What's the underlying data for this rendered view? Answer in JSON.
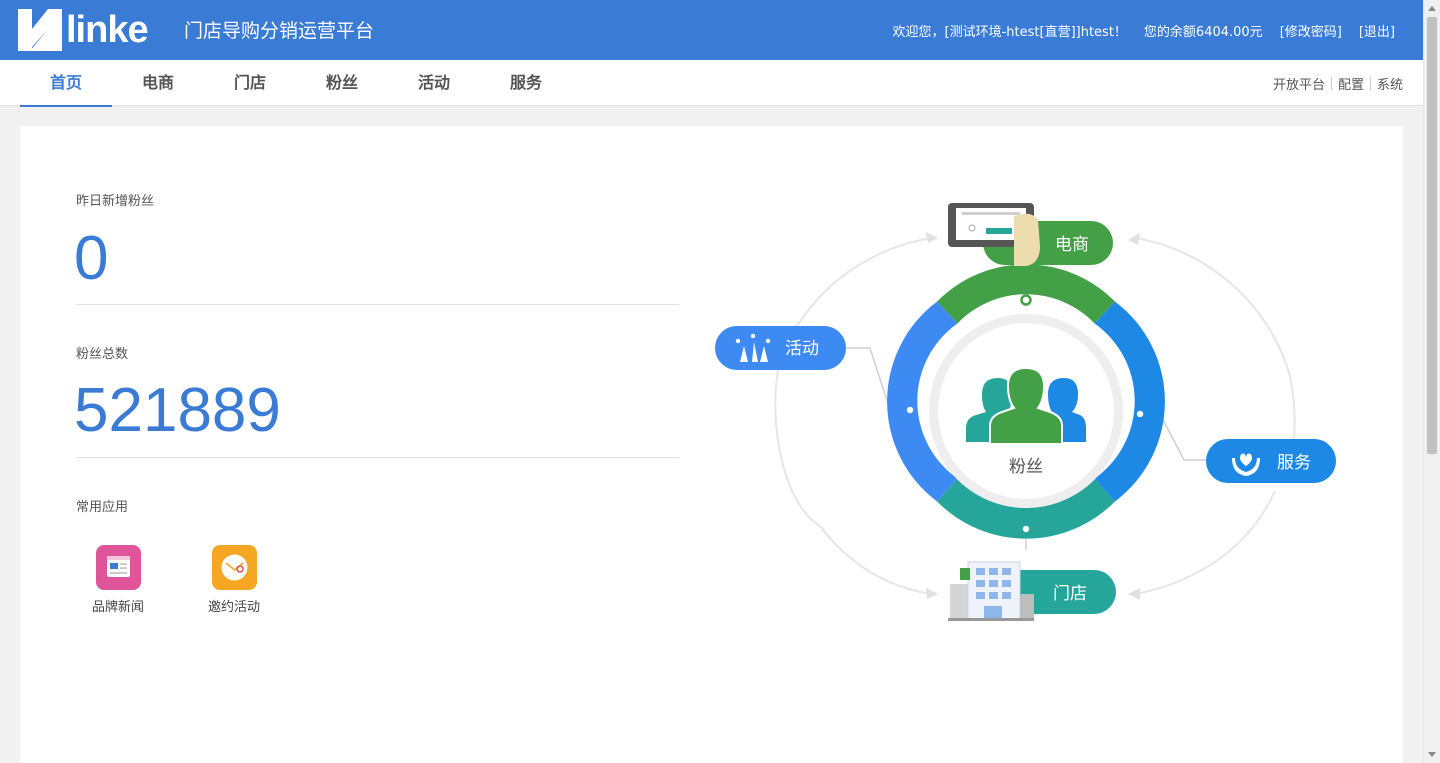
{
  "header": {
    "logo_text": "linke",
    "platform_title": "门店导购分销运营平台",
    "welcome": "欢迎您，[测试环境-htest[直营]]htest！",
    "balance": "您的余额6404.00元",
    "change_password": "[修改密码]",
    "logout": "[退出]"
  },
  "nav": {
    "tabs": [
      {
        "label": "首页",
        "active": true
      },
      {
        "label": "电商"
      },
      {
        "label": "门店"
      },
      {
        "label": "粉丝"
      },
      {
        "label": "活动"
      },
      {
        "label": "服务"
      }
    ],
    "right_links": [
      "开放平台",
      "配置",
      "系统"
    ]
  },
  "stats": {
    "yesterday_new_fans_label": "昨日新增粉丝",
    "yesterday_new_fans_value": "0",
    "total_fans_label": "粉丝总数",
    "total_fans_value": "521889"
  },
  "apps": {
    "section_label": "常用应用",
    "items": [
      {
        "label": "品牌新闻",
        "icon": "news-icon",
        "color": "#e0559a"
      },
      {
        "label": "邀约活动",
        "icon": "invite-mail-icon",
        "color": "#f5a623"
      }
    ]
  },
  "diagram": {
    "center_label": "粉丝",
    "nodes": {
      "ecommerce": {
        "label": "电商",
        "color": "#43a047"
      },
      "activity": {
        "label": "活动",
        "color": "#3d8af2"
      },
      "service": {
        "label": "服务",
        "color": "#1e88e5"
      },
      "store": {
        "label": "门店",
        "color": "#26a69a"
      }
    },
    "ring_colors": {
      "top": "#43a047",
      "left": "#3d8af2",
      "right": "#1e88e5",
      "bottom": "#26a69a"
    }
  }
}
